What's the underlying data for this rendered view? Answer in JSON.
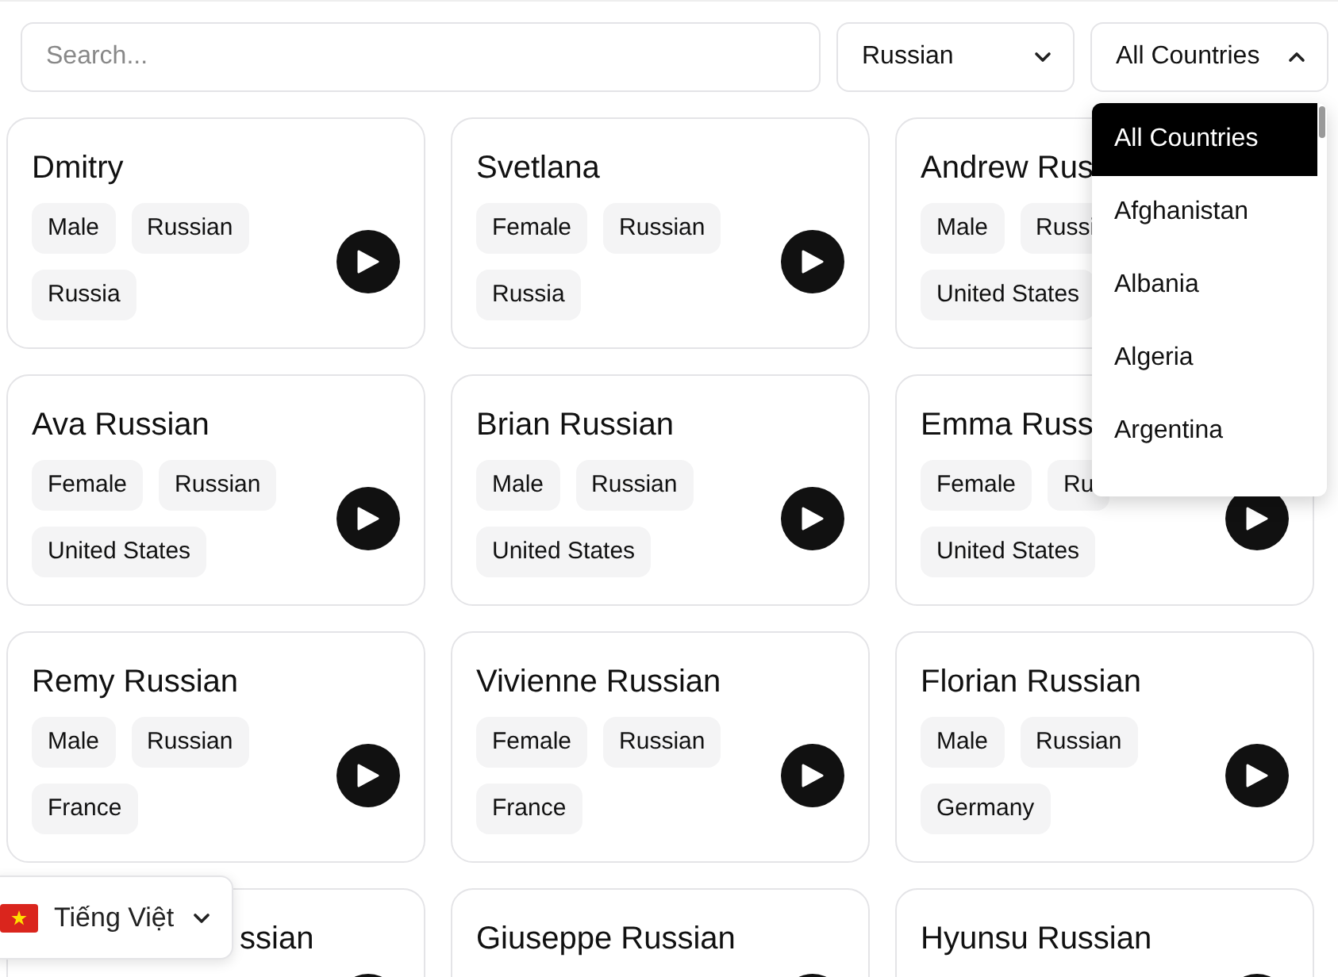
{
  "search": {
    "placeholder": "Search..."
  },
  "language_filter": {
    "value": "Russian",
    "expanded": false
  },
  "country_filter": {
    "value": "All Countries",
    "expanded": true
  },
  "country_options": [
    {
      "label": "All Countries",
      "selected": true
    },
    {
      "label": "Afghanistan",
      "selected": false
    },
    {
      "label": "Albania",
      "selected": false
    },
    {
      "label": "Algeria",
      "selected": false
    },
    {
      "label": "Argentina",
      "selected": false
    }
  ],
  "voices": [
    {
      "name": "Dmitry",
      "tags": [
        "Male",
        "Russian",
        "Russia"
      ]
    },
    {
      "name": "Svetlana",
      "tags": [
        "Female",
        "Russian",
        "Russia"
      ]
    },
    {
      "name": "Andrew Rus",
      "tags": [
        "Male",
        "Russi",
        "United States"
      ]
    },
    {
      "name": "Ava Russian",
      "tags": [
        "Female",
        "Russian",
        "United States"
      ]
    },
    {
      "name": "Brian Russian",
      "tags": [
        "Male",
        "Russian",
        "United States"
      ]
    },
    {
      "name": "Emma Russ",
      "tags": [
        "Female",
        "Ru",
        "United States"
      ]
    },
    {
      "name": "Remy Russian",
      "tags": [
        "Male",
        "Russian",
        "France"
      ]
    },
    {
      "name": "Vivienne Russian",
      "tags": [
        "Female",
        "Russian",
        "France"
      ]
    },
    {
      "name": "Florian Russian",
      "tags": [
        "Male",
        "Russian",
        "Germany"
      ]
    },
    {
      "name": "ssian"
    },
    {
      "name": "Giuseppe Russian"
    },
    {
      "name": "Hyunsu Russian"
    }
  ],
  "locale_switcher": {
    "label": "Tiếng Việt"
  }
}
